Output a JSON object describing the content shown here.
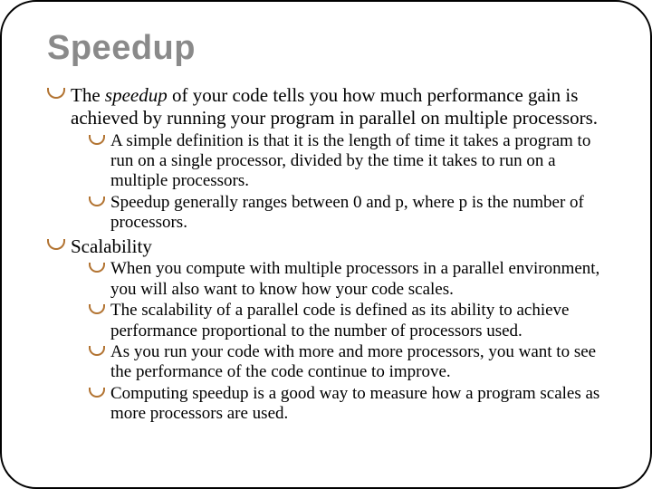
{
  "title": "Speedup",
  "bullets": {
    "b1_pre": "The ",
    "b1_em": "speedup",
    "b1_post": " of your code tells you how much performance gain is achieved by running your program in parallel on multiple processors.",
    "b1_sub1": "A simple definition is that it is the length of time it takes a program to run on a single processor, divided by the time it takes to run on a multiple processors.",
    "b1_sub2": "Speedup generally ranges between 0 and p, where p is the number of processors.",
    "b2": "Scalability",
    "b2_sub1": "When you compute with multiple processors in a parallel environment, you will also want to know how your code scales.",
    "b2_sub2": "The scalability of a parallel code is defined as its ability to achieve performance proportional to the number of processors used.",
    "b2_sub3": "As you run your code with more and more processors, you want to see the performance of the code continue to improve.",
    "b2_sub4": "Computing speedup is a good way to measure how a program scales as more processors are used."
  }
}
